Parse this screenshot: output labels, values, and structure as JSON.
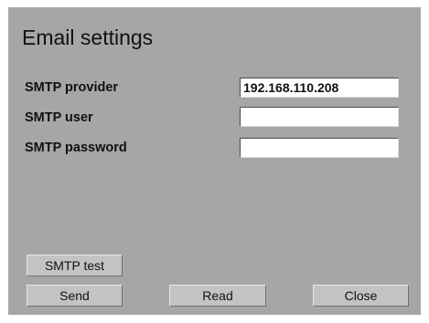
{
  "dialog": {
    "title": "Email settings"
  },
  "fields": {
    "smtp_provider": {
      "label": "SMTP provider",
      "value": "192.168.110.208"
    },
    "smtp_user": {
      "label": "SMTP user",
      "value": ""
    },
    "smtp_password": {
      "label": "SMTP password",
      "value": ""
    }
  },
  "buttons": {
    "smtp_test": "SMTP test",
    "send": "Send",
    "read": "Read",
    "close": "Close"
  }
}
